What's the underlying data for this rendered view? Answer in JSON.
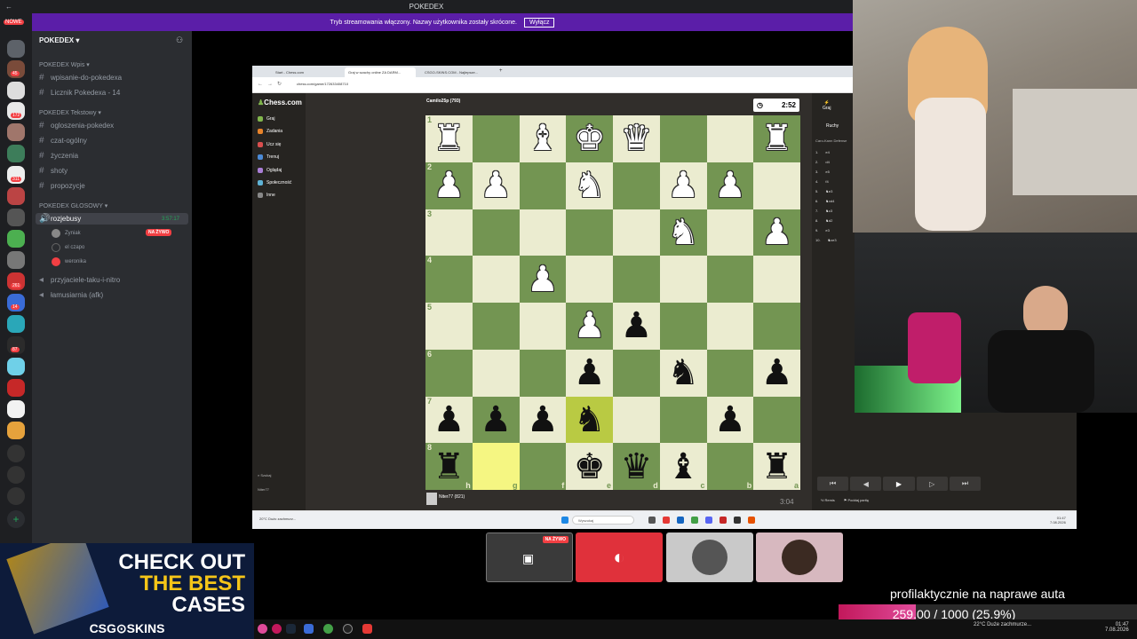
{
  "app": {
    "title": "POKEDEX"
  },
  "banner": {
    "text": "Tryb streamowania włączony. Nazwy użytkownika zostały skrócone.",
    "button": "Wyłącz"
  },
  "rail": {
    "new_label": "NOWE",
    "badges": [
      "45",
      "172",
      "311",
      "261",
      "14",
      "87"
    ]
  },
  "sidebar": {
    "server": "POKEDEX",
    "categories": [
      "POKEDEX Wpis",
      "POKEDEX Tekstowy",
      "POKEDEX GŁOSOWY"
    ],
    "channels_wpis": [
      "wpisanie-do-pokedexa",
      "Licznik Pokedexa - 14"
    ],
    "channels_text": [
      "ogloszenia-pokedex",
      "czat-ogólny",
      "życzenia",
      "shoty",
      "propozycje"
    ],
    "voice_active": "rozjebusy",
    "voice_timer": "3:57:17",
    "voice_users": [
      "Zyniak",
      "el czapo",
      "weronika"
    ],
    "live_badge": "NA ŻYWO",
    "voice_other": [
      "przyjaciele-taku-i-nitro",
      "łamusiarnia (afk)"
    ]
  },
  "browser": {
    "tabs": [
      "Start - Chess.com",
      "Graj w szachy online ZA DARM...",
      "CSGO-SKINS.COM - Najlepsze..."
    ],
    "url": "chess.com/game/172633408710"
  },
  "chess": {
    "logo": "Chess.com",
    "nav": [
      "Graj",
      "Zadania",
      "Ucz się",
      "Trenuj",
      "Oglądaj",
      "Społeczność",
      "Inne"
    ],
    "search": "Szukaj",
    "user": "Niter77",
    "top_player": "Camilo25p (793)",
    "top_clock": "2:52",
    "bottom_player": "Niter77 (821)",
    "bottom_clock": "3:04",
    "rank_labels": [
      "1",
      "2",
      "3",
      "4",
      "5",
      "6",
      "7",
      "8"
    ],
    "file_labels": [
      "h",
      "g",
      "f",
      "e",
      "d",
      "c",
      "b",
      "a"
    ],
    "rows": [
      [
        "♜",
        "",
        "♝",
        "♚",
        "♛",
        "",
        "",
        "♜"
      ],
      [
        "♟",
        "♟",
        "",
        "♞",
        "",
        "♟",
        "♟",
        ""
      ],
      [
        "",
        "",
        "",
        "",
        "",
        "♞",
        "",
        "♟"
      ],
      [
        "",
        "",
        "♟",
        "",
        "",
        "",
        "",
        ""
      ],
      [
        "",
        "",
        "",
        "♟",
        "♟",
        "",
        "",
        ""
      ],
      [
        "",
        "",
        "",
        "♟",
        "",
        "♞",
        "",
        "♟"
      ],
      [
        "♟",
        "♟",
        "♟",
        "♞",
        "",
        "",
        "♟",
        ""
      ],
      [
        "♜",
        "",
        "",
        "♚",
        "♛",
        "♝",
        "",
        "♜"
      ]
    ],
    "colors": [
      [
        "w",
        "",
        "w",
        "w",
        "w",
        "",
        "",
        "w"
      ],
      [
        "w",
        "w",
        "",
        "w",
        "",
        "w",
        "w",
        ""
      ],
      [
        "",
        "",
        "",
        "",
        "",
        "w",
        "",
        "w"
      ],
      [
        "",
        "",
        "w",
        "",
        "",
        "",
        "",
        ""
      ],
      [
        "",
        "",
        "",
        "w",
        "b",
        "",
        "",
        ""
      ],
      [
        "",
        "",
        "",
        "b",
        "",
        "b",
        "",
        "b"
      ],
      [
        "b",
        "b",
        "b",
        "b",
        "",
        "",
        "b",
        ""
      ],
      [
        "b",
        "",
        "",
        "b",
        "b",
        "b",
        "",
        "b"
      ]
    ],
    "panel": {
      "play_label": "Graj",
      "moves_title": "Ruchy",
      "opening": "Caro-Kann Defense",
      "moves": [
        [
          "1.",
          "e4"
        ],
        [
          "2.",
          "d4"
        ],
        [
          "3.",
          "e5"
        ],
        [
          "4.",
          "f4"
        ],
        [
          "5.",
          "♞e3"
        ],
        [
          "6.",
          "♞xd4"
        ],
        [
          "7.",
          "♞c3"
        ],
        [
          "8.",
          "♞d2"
        ],
        [
          "9.",
          "e3"
        ],
        [
          "10.",
          "♞xe3"
        ]
      ],
      "draw": "Remis",
      "resign": "Poddaj partię"
    }
  },
  "win": {
    "weather": "20°C Dużo zachmurz...",
    "search": "Wyszukaj",
    "time": "01:47",
    "date": "7.08.2026"
  },
  "tiles": {
    "live": "NA ŻYWO"
  },
  "ad": {
    "line1": "CHECK OUT",
    "line2": "THE BEST",
    "line3": "CASES",
    "brand": "CSG⊙SKINS"
  },
  "goal": {
    "title": "profilaktycznie na naprawe auta",
    "text": "259.00 / 1000 (25.9%)",
    "progress": 0.259
  },
  "os": {
    "weather": "22°C Duże zachmurze...",
    "time": "01:47",
    "date": "7.08.2026"
  },
  "colors": {
    "discord_purple": "#5b1ea8",
    "chess_dark": "#739552",
    "chess_light": "#ebecd0",
    "goal_pink": "#e04b9a"
  }
}
